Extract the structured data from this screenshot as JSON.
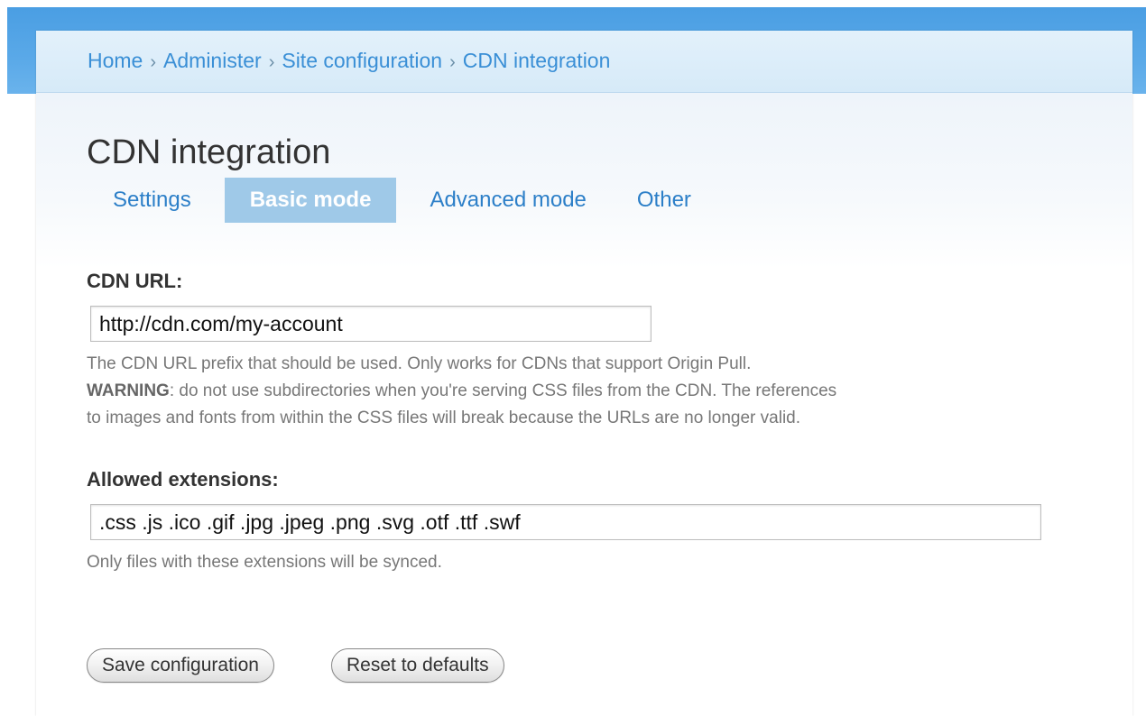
{
  "breadcrumb": {
    "items": [
      "Home",
      "Administer",
      "Site configuration",
      "CDN integration"
    ],
    "separator": "›"
  },
  "page": {
    "title": "CDN integration"
  },
  "tabs": [
    {
      "label": "Settings",
      "active": false
    },
    {
      "label": "Basic mode",
      "active": true
    },
    {
      "label": "Advanced mode",
      "active": false
    },
    {
      "label": "Other",
      "active": false
    }
  ],
  "form": {
    "cdn_url": {
      "label": "CDN URL:",
      "value": "http://cdn.com/my-account",
      "description_line1": "The CDN URL prefix that should be used. Only works for CDNs that support Origin Pull.",
      "warning_label": "WARNING",
      "warning_line1_rest": ": do not use subdirectories when you're serving CSS files from the CDN. The references",
      "warning_line2": "to images and fonts from within the CSS files will break because the URLs are no longer valid."
    },
    "allowed_extensions": {
      "label": "Allowed extensions:",
      "value": ".css .js .ico .gif .jpg .jpeg .png .svg .otf .ttf .swf",
      "description": "Only files with these extensions will be synced."
    }
  },
  "buttons": {
    "save": "Save configuration",
    "reset": "Reset to defaults"
  },
  "colors": {
    "accent_blue": "#3a8fd6",
    "active_tab_bg": "#9fc9e8",
    "top_bar": "#4a9ee3"
  }
}
